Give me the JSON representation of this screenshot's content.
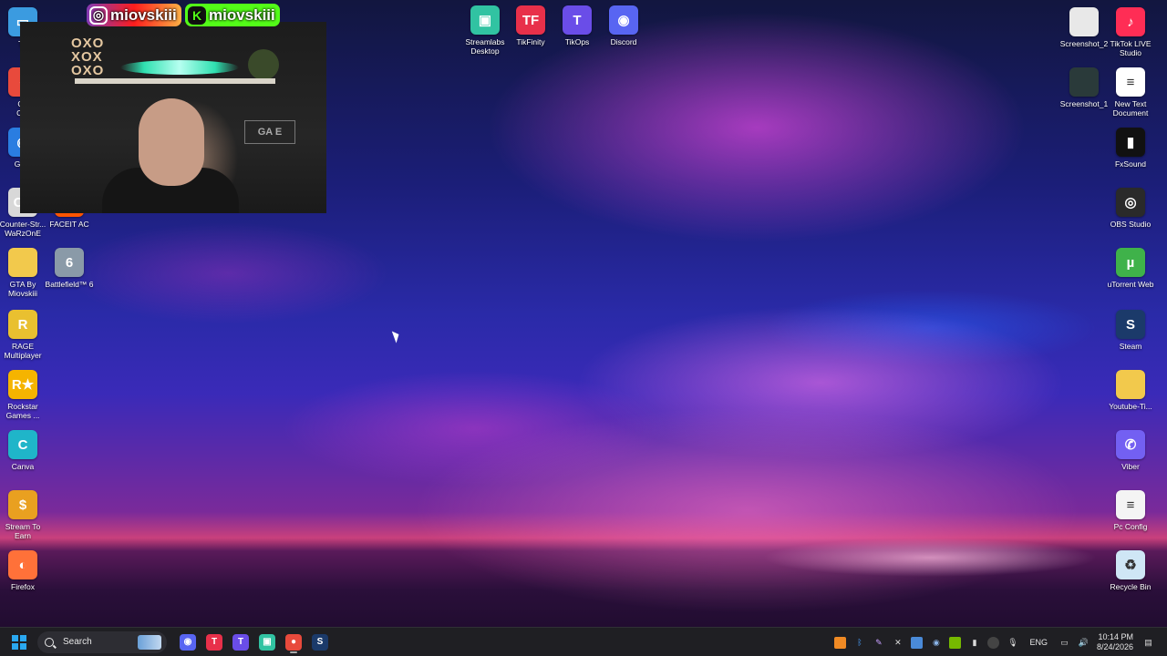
{
  "desktop": {
    "left_icons": [
      {
        "label": "Th",
        "icon": "this-pc-icon",
        "color": "#3b9be0"
      },
      {
        "label": "Go\nChr",
        "icon": "chrome-icon",
        "color": "#e84a3c"
      },
      {
        "label": "Gam",
        "icon": "game-icon",
        "color": "#2a7de1"
      },
      {
        "label": "Counter-Str...\nWaRzOnE",
        "icon": "counter-strike-icon",
        "color": "#d8d8d8"
      },
      {
        "label": "FACEIT AC",
        "icon": "faceit-icon",
        "color": "#ff5500"
      },
      {
        "label": "GTA By\nMiovskiii",
        "icon": "folder-icon",
        "color": "#f2c94c"
      },
      {
        "label": "Battlefield™ 6",
        "icon": "battlefield-icon",
        "color": "#8a9aa8"
      },
      {
        "label": "RAGE\nMultiplayer",
        "icon": "rage-mp-icon",
        "color": "#e9c030"
      },
      {
        "label": "Rockstar\nGames ...",
        "icon": "rockstar-icon",
        "color": "#f5b400"
      },
      {
        "label": "Canva",
        "icon": "canva-icon",
        "color": "#1fb5c9"
      },
      {
        "label": "Stream To\nEarn",
        "icon": "stream-to-earn-icon",
        "color": "#e9a020"
      },
      {
        "label": "Firefox",
        "icon": "firefox-icon",
        "color": "#ff7139"
      }
    ],
    "top_icons": [
      {
        "label": "Streamlabs\nDesktop",
        "icon": "streamlabs-icon",
        "color": "#31c3a2"
      },
      {
        "label": "TikFinity",
        "icon": "tikfinity-icon",
        "color": "#e8304a"
      },
      {
        "label": "TikOps",
        "icon": "tikops-icon",
        "color": "#6a4de8"
      },
      {
        "label": "Discord",
        "icon": "discord-icon",
        "color": "#5865f2"
      }
    ],
    "right_icons": [
      {
        "label": "Screenshot_2",
        "icon": "image-file-icon",
        "color": "#e8e8e8"
      },
      {
        "label": "TikTok LIVE\nStudio",
        "icon": "tiktok-live-icon",
        "color": "#ff2d55"
      },
      {
        "label": "Screenshot_1",
        "icon": "image-file-icon",
        "color": "#2a3a3a"
      },
      {
        "label": "New Text\nDocument",
        "icon": "text-file-icon",
        "color": "#ffffff"
      },
      {
        "label": "FxSound",
        "icon": "fxsound-icon",
        "color": "#111111"
      },
      {
        "label": "OBS Studio",
        "icon": "obs-icon",
        "color": "#2a2a2a"
      },
      {
        "label": "uTorrent Web",
        "icon": "utorrent-icon",
        "color": "#3fb24a"
      },
      {
        "label": "Steam",
        "icon": "steam-icon",
        "color": "#1b3a6a"
      },
      {
        "label": "Youtube-Ti...",
        "icon": "folder-icon",
        "color": "#f2c94c"
      },
      {
        "label": "Viber",
        "icon": "viber-icon",
        "color": "#7360f2"
      },
      {
        "label": "Pc Config",
        "icon": "text-file-icon",
        "color": "#f4f4f4"
      },
      {
        "label": "Recycle Bin",
        "icon": "recycle-bin-icon",
        "color": "#cfe6f5"
      }
    ]
  },
  "overlay": {
    "instagram_handle": "miovskiii",
    "kick_handle": "miovskiii",
    "kick_letter": "K",
    "webcam_sign": "GA  E",
    "webcam_oxo": "OXO\nXOX\nOXO"
  },
  "taskbar": {
    "search_label": "Search",
    "pinned": [
      {
        "icon": "discord-icon",
        "color": "#5865f2",
        "glyph": "◉"
      },
      {
        "icon": "tikfinity-icon",
        "color": "#e8304a",
        "glyph": "T"
      },
      {
        "icon": "tikops-icon",
        "color": "#6a4de8",
        "glyph": "T"
      },
      {
        "icon": "streamlabs-icon",
        "color": "#31c3a2",
        "glyph": "▣"
      },
      {
        "icon": "chrome-icon",
        "color": "#e84a3c",
        "glyph": "●"
      },
      {
        "icon": "steam-icon",
        "color": "#1b3a6a",
        "glyph": "S"
      }
    ],
    "language": "ENG",
    "time": "10:14 PM",
    "date": "8/24/2026"
  }
}
